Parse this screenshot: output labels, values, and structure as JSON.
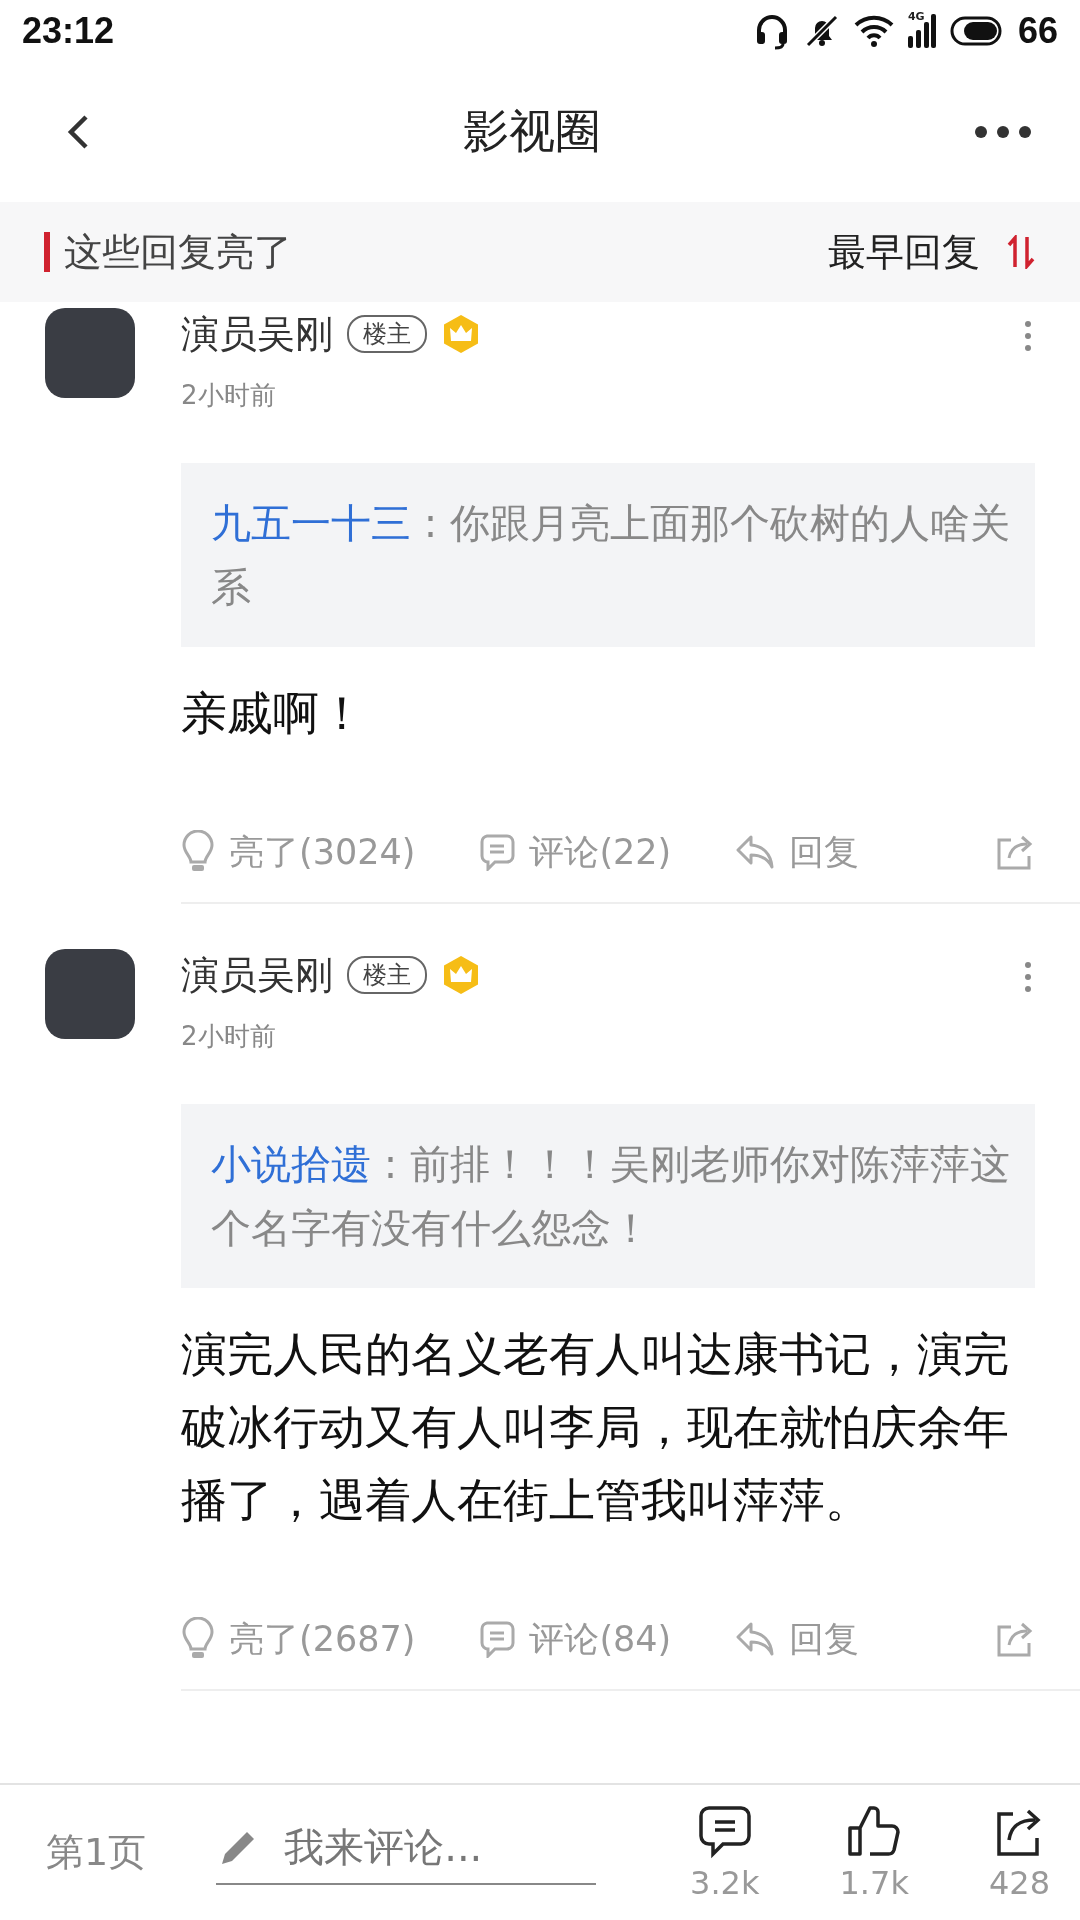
{
  "status_bar": {
    "time": "23:12",
    "network": "4G",
    "battery": "66"
  },
  "nav": {
    "title": "影视圈"
  },
  "section": {
    "title": "这些回复亮了",
    "sort_label": "最早回复"
  },
  "posts": [
    {
      "name": "演员吴刚",
      "badge": "楼主",
      "time": "2小时前",
      "quote": {
        "user": "九五一十三",
        "text": ": 你跟月亮上面那个砍树的人啥关系"
      },
      "body": "亲戚啊！",
      "actions": [
        {
          "kind": "light",
          "label": "亮了(3024)"
        },
        {
          "kind": "comment",
          "label": "评论(22)"
        },
        {
          "kind": "reply",
          "label": "回复"
        }
      ]
    },
    {
      "name": "演员吴刚",
      "badge": "楼主",
      "time": "2小时前",
      "quote": {
        "user": "小说拾遗",
        "text": ": 前排！！！吴刚老师你对陈萍萍这个名字有没有什么怨念！"
      },
      "body": "演完人民的名义老有人叫达康书记，演完破冰行动又有人叫李局，现在就怕庆余年播了，遇着人在街上管我叫萍萍。",
      "actions": [
        {
          "kind": "light",
          "label": "亮了(2687)"
        },
        {
          "kind": "comment",
          "label": "评论(84)"
        },
        {
          "kind": "reply",
          "label": "回复"
        }
      ]
    }
  ],
  "bottom_bar": {
    "page": "第1页",
    "comment_placeholder": "我来评论...",
    "stats": [
      {
        "kind": "comments",
        "count": "3.2k"
      },
      {
        "kind": "likes",
        "count": "1.7k"
      },
      {
        "kind": "share",
        "count": "428"
      }
    ]
  }
}
